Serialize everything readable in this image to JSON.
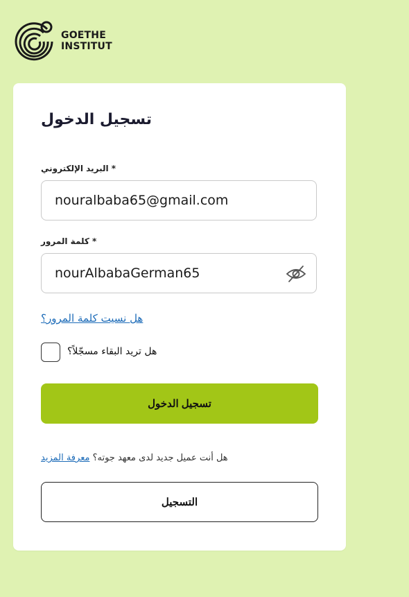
{
  "brand": {
    "line1": "GOETHE",
    "line2": "INSTITUT"
  },
  "form": {
    "title": "تسجيل الدخول",
    "email_label": "* البريد الإلكتروني",
    "email_value": "nouralbaba65@gmail.com",
    "password_label": "* كلمة المرور",
    "password_value": "nourAlbabaGerman65",
    "forgot_link": "هل نسيت كلمة المرور؟",
    "stay_logged_in_label": "هل تريد البقاء مسجّلاً؟",
    "stay_logged_in_checked": false,
    "login_button": "تسجيل الدخول",
    "new_customer_text": "هل أنت عميل جديد لدى معهد جوته؟",
    "learn_more_link": "معرفة المزيد",
    "register_button": "التسجيل"
  },
  "icons": {
    "logo": "goethe-logo-icon",
    "password_toggle": "eye-slash-icon"
  },
  "colors": {
    "background": "#dff2b2",
    "primary_button": "#a2c617",
    "link": "#1c6bb8"
  }
}
